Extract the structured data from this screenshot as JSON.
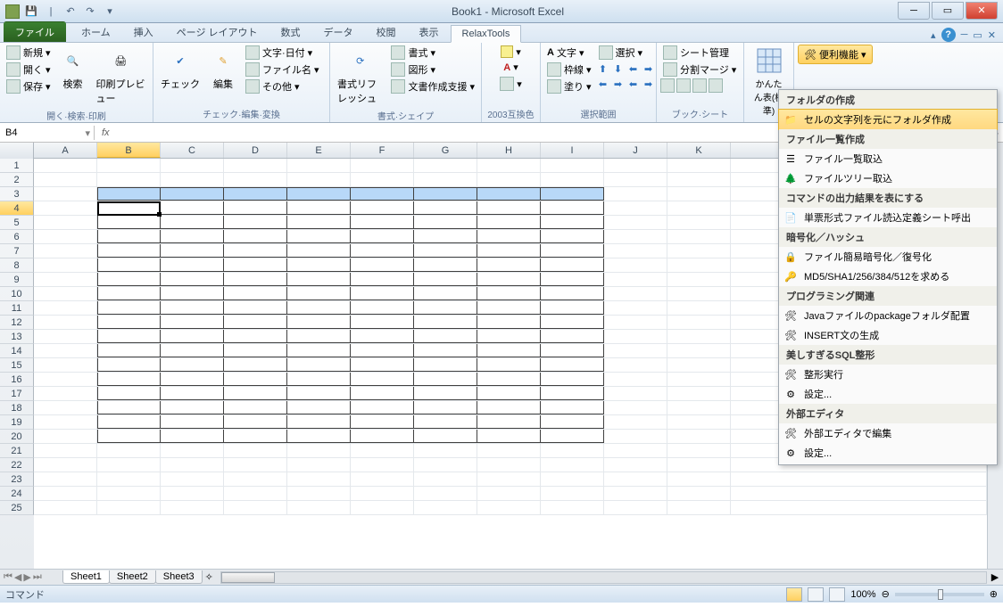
{
  "title": "Book1 - Microsoft Excel",
  "qat_tips": [
    "save",
    "undo",
    "redo"
  ],
  "tabs": {
    "file": "ファイル",
    "list": [
      "ホーム",
      "挿入",
      "ページ レイアウト",
      "数式",
      "データ",
      "校閲",
      "表示",
      "RelaxTools"
    ],
    "active": "RelaxTools"
  },
  "ribbon": {
    "g1": {
      "label": "開く·検索·印刷",
      "new": "新規",
      "open": "開く",
      "save": "保存",
      "search": "検索",
      "preview": "印刷プレビュー"
    },
    "g2": {
      "label": "チェック·編集·変換",
      "check": "チェック",
      "edit": "編集",
      "mojidate": "文字·日付",
      "filename": "ファイル名",
      "other": "その他"
    },
    "g3": {
      "label": "書式·シェイプ",
      "refresh": "書式リフレッシュ",
      "format": "書式",
      "shape": "図形",
      "docsup": "文書作成支援"
    },
    "g4": {
      "label": "2003互換色"
    },
    "g5": {
      "label": "選択範囲",
      "moji": "文字",
      "waku": "枠線",
      "nuri": "塗り",
      "select": "選択"
    },
    "g6": {
      "label": "ブック·シート",
      "sheet": "シート管理",
      "split": "分割マージ"
    },
    "g7": {
      "label": "",
      "kantan": "かんたん表(標準)"
    },
    "g8": {
      "benri": "便利機能"
    }
  },
  "namebox": "B4",
  "columns": [
    "A",
    "B",
    "C",
    "D",
    "E",
    "F",
    "G",
    "H",
    "I",
    "J",
    "K"
  ],
  "rows_count": 25,
  "selected_col": "B",
  "selected_row": 4,
  "sheets": [
    "Sheet1",
    "Sheet2",
    "Sheet3"
  ],
  "active_sheet": "Sheet1",
  "status": "コマンド",
  "zoom": "100%",
  "dropdown": {
    "s1": "フォルダの作成",
    "i1": "セルの文字列を元にフォルダ作成",
    "s2": "ファイル一覧作成",
    "i2": "ファイル一覧取込",
    "i3": "ファイルツリー取込",
    "s3": "コマンドの出力結果を表にする",
    "i4": "単票形式ファイル読込定義シート呼出",
    "s4": "暗号化／ハッシュ",
    "i5": "ファイル簡易暗号化／復号化",
    "i6": "MD5/SHA1/256/384/512を求める",
    "s5": "プログラミング関連",
    "i7": "Javaファイルのpackageフォルダ配置",
    "i8": "INSERT文の生成",
    "s6": "美しすぎるSQL整形",
    "i9": "整形実行",
    "i10": "設定...",
    "s7": "外部エディタ",
    "i11": "外部エディタで編集",
    "i12": "設定..."
  }
}
